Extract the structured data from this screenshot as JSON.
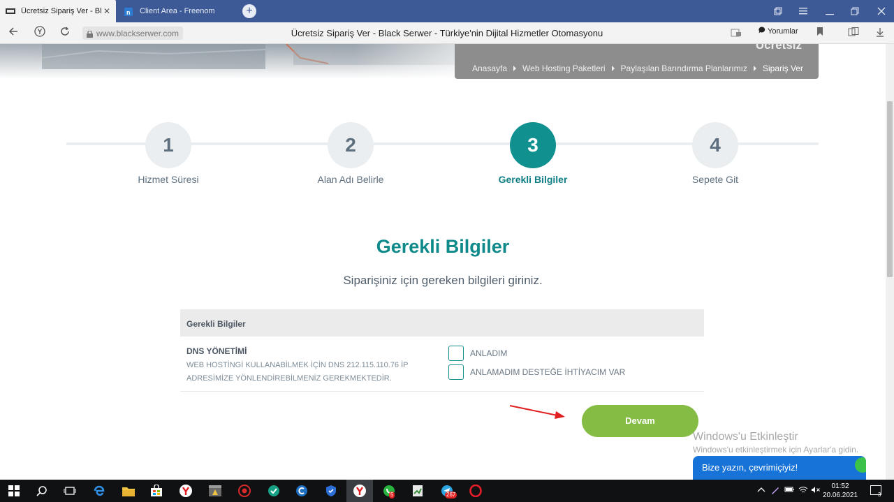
{
  "browser": {
    "tabs": [
      {
        "title": "Ücretsiz Sipariş Ver - Bla",
        "active": true,
        "close": "✕"
      },
      {
        "title": "Client Area - Freenom",
        "active": false
      }
    ],
    "new_tab": "+",
    "url": "www.blackserwer.com",
    "page_title": "Ücretsiz Sipariş Ver - Black Serwer - Türkiye'nin Dijital Hizmetler Otomasyonu",
    "comments_label": "Yorumlar"
  },
  "hero": {
    "heading": "Ücretsiz",
    "breadcrumbs": [
      "Anasayfa",
      "Web Hosting Paketleri",
      "Paylaşılan Barındırma Planlarımız",
      "Sipariş Ver"
    ]
  },
  "steps": [
    {
      "number": "1",
      "label": "Hizmet Süresi"
    },
    {
      "number": "2",
      "label": "Alan Adı Belirle"
    },
    {
      "number": "3",
      "label": "Gerekli Bilgiler"
    },
    {
      "number": "4",
      "label": "Sepete Git"
    }
  ],
  "active_step": 3,
  "section": {
    "title": "Gerekli Bilgiler",
    "subtitle": "Siparişiniz için gereken bilgileri giriniz."
  },
  "panel": {
    "header": "Gerekli Bilgiler",
    "dns_title": "DNS YÖNETİMİ",
    "dns_desc": "WEB HOSTİNGİ KULLANABİLMEK İÇİN DNS 212.115.110.76 İP ADRESİMİZE YÖNLENDİREBİLMENİZ GEREKMEKTEDİR.",
    "options": [
      "ANLADIM",
      "ANLAMADIM DESTEĞE İHTİYACIM VAR"
    ]
  },
  "continue_button": "Devam",
  "windows_activation": {
    "title": "Windows'u Etkinleştir",
    "subtitle": "Windows'u etkinleştirmek için Ayarlar'a gidin."
  },
  "chat_widget": "Bize yazın, çevrimiçiyiz!",
  "taskbar": {
    "whatsapp_badge": "5",
    "telegram_badge": "267",
    "time": "01:52",
    "date": "20.06.2021",
    "notification_count": "3"
  },
  "colors": {
    "accent_teal": "#119090",
    "button_green": "#85bd44",
    "tab_strip": "#3d5a97",
    "chat_blue": "#1773d8"
  }
}
